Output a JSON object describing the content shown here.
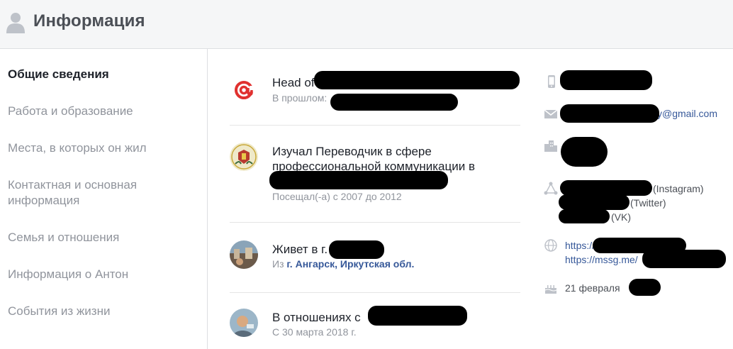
{
  "header": {
    "title": "Информация"
  },
  "sidebar": {
    "items": [
      {
        "label": "Общие сведения"
      },
      {
        "label": "Работа и образование"
      },
      {
        "label": "Места, в которых он жил"
      },
      {
        "label": "Контактная и основная информация"
      },
      {
        "label": "Семья и отношения"
      },
      {
        "label": "Информация о Антон"
      },
      {
        "label": "События из жизни"
      }
    ]
  },
  "entries": {
    "work": {
      "title": "Head of",
      "sub": "В прошлом:"
    },
    "education": {
      "title": "Изучал Переводчик в сфере профессиональной коммуникации в",
      "sub": "Посещал(-а) с 2007 до 2012"
    },
    "lives": {
      "title": "Живет в г.",
      "sub_prefix": "Из",
      "sub_place": "г. Ангарск, Иркутская обл."
    },
    "relationship": {
      "title": "В отношениях с",
      "sub": "С 30 марта 2018 г."
    }
  },
  "contacts": {
    "email_suffix": "y@gmail.com",
    "instagram": "(Instagram)",
    "twitter": "(Twitter)",
    "vk": "(VK)",
    "website1": "https://",
    "website2": "https://mssg.me/",
    "birthday": "21 февраля"
  },
  "colors": {
    "accent": "#365899",
    "muted": "#90949c",
    "text": "#1d2129",
    "header_bg": "#f5f6f7"
  }
}
